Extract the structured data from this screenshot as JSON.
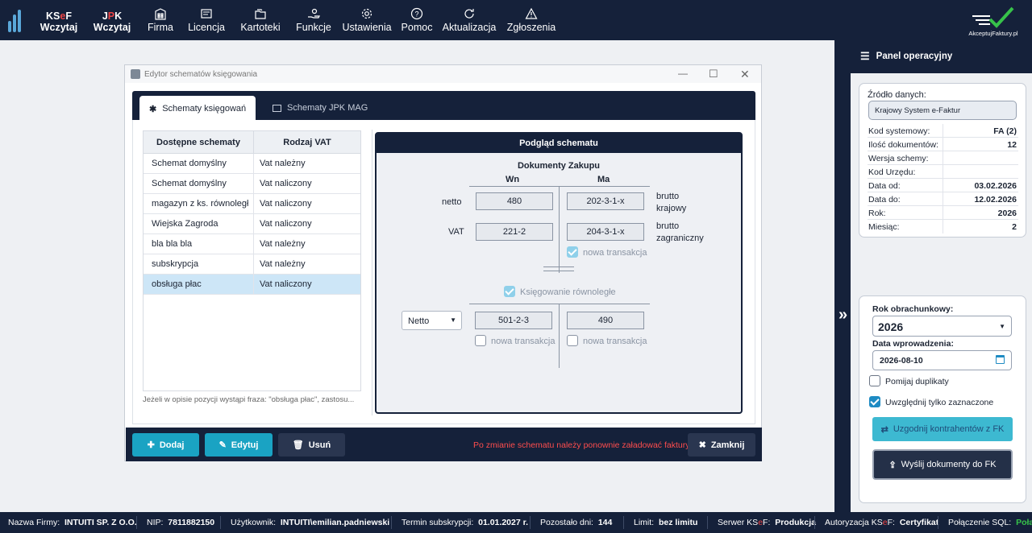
{
  "topbar": {
    "ksef_brand": [
      "KS",
      "e",
      "F"
    ],
    "ksef_label": "Wczytaj",
    "jpk_brand": [
      "J",
      "P",
      "K"
    ],
    "jpk_label": "Wczytaj",
    "menu": [
      "Firma",
      "Licencja",
      "Kartoteki",
      "Funkcje",
      "Ustawienia",
      "Pomoc",
      "Aktualizacja",
      "Zgłoszenia"
    ],
    "akceptuj_logo_text": "AkceptujFaktury.pl"
  },
  "dialog": {
    "title": "Edytor schematów księgowania",
    "tabs": [
      "Schematy księgowań",
      "Schematy JPK MAG"
    ],
    "table": {
      "headers": [
        "Dostępne schematy",
        "Rodzaj VAT"
      ],
      "rows": [
        [
          "Schemat domyślny",
          "Vat należny"
        ],
        [
          "Schemat domyślny",
          "Vat naliczony"
        ],
        [
          "magazyn z ks. równoległ",
          "Vat naliczony"
        ],
        [
          "Wiejska Zagroda",
          "Vat naliczony"
        ],
        [
          "bla bla bla",
          "Vat należny"
        ],
        [
          "subskrypcja",
          "Vat należny"
        ],
        [
          "obsługa płac",
          "Vat naliczony"
        ]
      ],
      "selected_row": 6
    },
    "hint": "Jeżeli w opisie pozycji wystąpi fraza: \"obsługa płac\", zastosu...",
    "preview": {
      "title": "Podgląd schematu",
      "subtitle": "Dokumenty Zakupu",
      "col_wn": "Wn",
      "col_ma": "Ma",
      "row_netto": "netto",
      "row_vat": "VAT",
      "netto_wn": "480",
      "netto_ma": "202-3-1-x",
      "vat_wn": "221-2",
      "vat_ma": "204-3-1-x",
      "side1": [
        "brutto",
        "krajowy"
      ],
      "side2": [
        "brutto",
        "zagraniczny"
      ],
      "nowa_transakcja": "nowa transakcja",
      "ksiegowanie_rownolegle": "Księgowanie równoległe",
      "netto_select": "Netto",
      "par_wn": "501-2-3",
      "par_ma": "490"
    },
    "buttons": {
      "add": "Dodaj",
      "edit": "Edytuj",
      "delete": "Usuń",
      "close": "Zamknij"
    },
    "warning": "Po zmianie schematu należy ponownie załadować faktury"
  },
  "panel": {
    "title": "Panel operacyjny",
    "source_label": "Źródło danych:",
    "source_value": "Krajowy System e-Faktur",
    "kv": [
      [
        "Kod systemowy:",
        "FA (2)"
      ],
      [
        "Ilość dokumentów:",
        "12"
      ],
      [
        "Wersja schemy:",
        ""
      ],
      [
        "Kod Urzędu:",
        ""
      ],
      [
        "Data od:",
        "03.02.2026"
      ],
      [
        "Data do:",
        "12.02.2026"
      ],
      [
        "Rok:",
        "2026"
      ],
      [
        "Miesiąc:",
        "2"
      ]
    ],
    "rok_label": "Rok obrachunkowy:",
    "rok_value": "2026",
    "data_label": "Data wprowadzenia:",
    "data_value": "2026-08-10",
    "pomijaj": "Pomijaj duplikaty",
    "uwzglednij": "Uwzględnij tylko zaznaczone",
    "uzgodnij": "Uzgodnij kontrahentów z FK",
    "wyslij": "Wyślij dokumenty do FK"
  },
  "status": {
    "firma_label": "Nazwa Firmy:",
    "firma": "INTUITI SP. Z O.O.",
    "nip_label": "NIP:",
    "nip": "7811882150",
    "user_label": "Użytkownik:",
    "user": "INTUITI\\emilian.padniewski",
    "term_label": "Termin subskrypcji:",
    "term": "01.01.2027 r.",
    "days_label": "Pozostało dni:",
    "days": "144",
    "limit_label": "Limit:",
    "limit": "bez limitu",
    "server_label": [
      "Serwer KS",
      "e",
      "F:"
    ],
    "server": "Produkcja",
    "auth_label": [
      "Autoryzacja KS",
      "e",
      "F:"
    ],
    "auth": "Certyfikat",
    "sql_label": "Połączenie SQL:",
    "sql": "Połączono"
  },
  "colors": {
    "navy": "#15213a",
    "teal": "#1aa3c3",
    "accent_red": "#e44"
  }
}
